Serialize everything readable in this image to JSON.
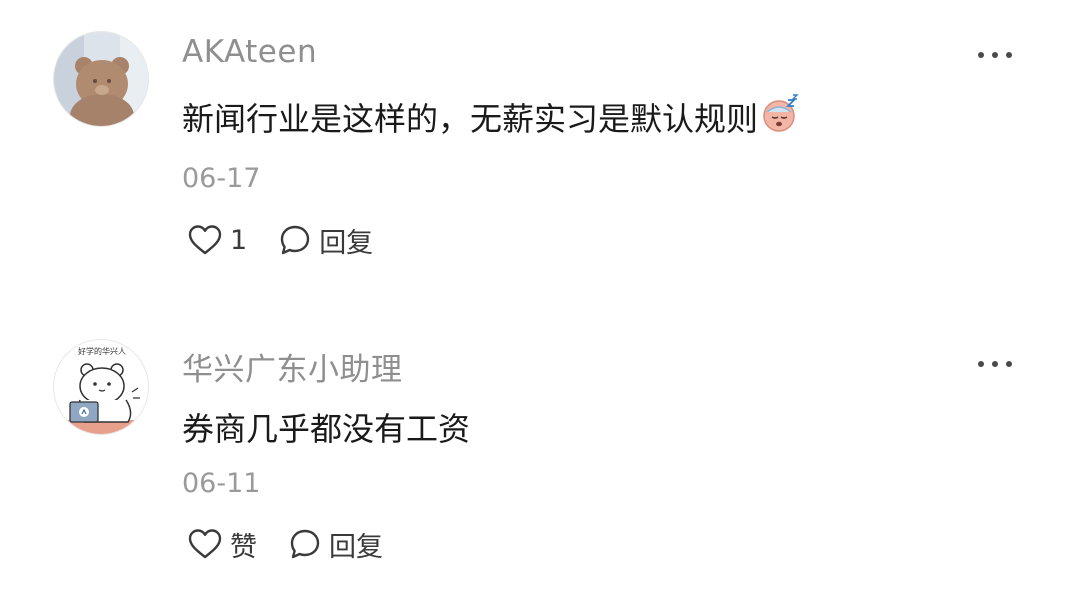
{
  "comments": [
    {
      "username": "AKAteen",
      "text": "新闻行业是这样的，无薪实习是默认规则",
      "emoji": "sleepy-face-emoji",
      "date": "06-17",
      "like_label": "1",
      "reply_label": "回复"
    },
    {
      "username": "华兴广东小助理",
      "avatar_caption": "好学的华兴人",
      "text": "券商几乎都没有工资",
      "date": "06-11",
      "like_label": "赞",
      "reply_label": "回复"
    }
  ],
  "colors": {
    "username": "#8f8f8f",
    "body_text": "#1a1a1a",
    "date": "#9a9a9a",
    "icon": "#3a3a3a"
  }
}
